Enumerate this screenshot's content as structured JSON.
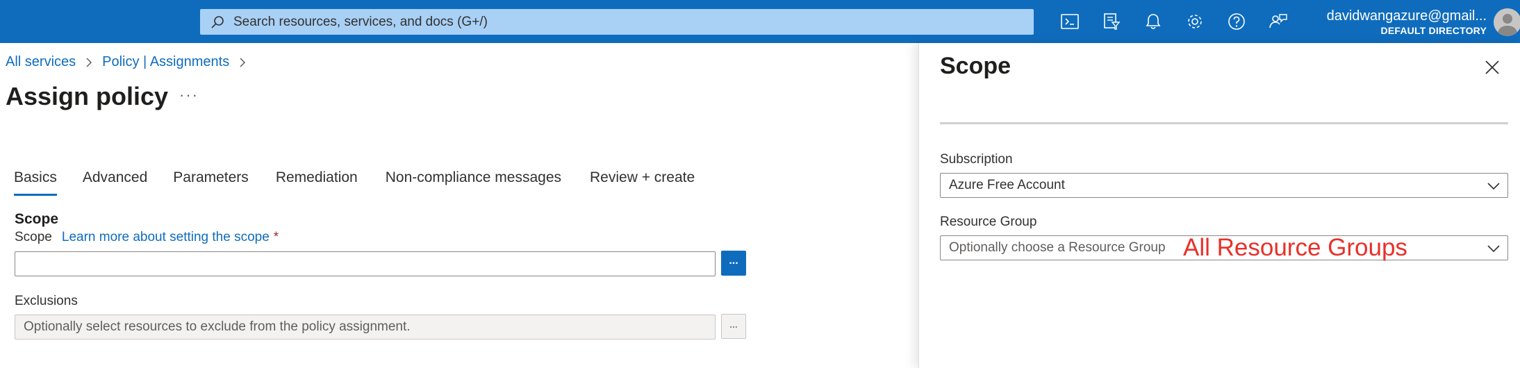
{
  "topbar": {
    "search_placeholder": "Search resources, services, and docs (G+/)",
    "icons": [
      "cloud-shell-icon",
      "directory-filter-icon",
      "notifications-icon",
      "settings-icon",
      "help-icon",
      "feedback-icon"
    ],
    "user_email": "davidwangazure@gmail...",
    "user_directory": "DEFAULT DIRECTORY"
  },
  "breadcrumb": {
    "items": [
      "All services",
      "Policy | Assignments"
    ]
  },
  "page": {
    "title": "Assign policy",
    "more": "···"
  },
  "tabs": [
    "Basics",
    "Advanced",
    "Parameters",
    "Remediation",
    "Non-compliance messages",
    "Review + create"
  ],
  "active_tab": "Basics",
  "basics": {
    "section_title": "Scope",
    "scope_label": "Scope",
    "scope_learn_more": "Learn more about setting the scope",
    "scope_required": "*",
    "scope_value": "",
    "scope_button": "...",
    "exclusions_label": "Exclusions",
    "exclusions_placeholder": "Optionally select resources to exclude from the policy assignment.",
    "exclusions_button": "..."
  },
  "blade": {
    "title": "Scope",
    "subscription_label": "Subscription",
    "subscription_value": "Azure Free Account",
    "resource_group_label": "Resource Group",
    "resource_group_placeholder": "Optionally choose a Resource Group"
  },
  "annotation": {
    "text": "All Resource Groups",
    "color": "#e8302a"
  },
  "colors": {
    "accent": "#0f6cbd",
    "topbar_bg": "#0f6cbd",
    "search_bg": "#a9d0f5",
    "required": "#a4262c"
  }
}
